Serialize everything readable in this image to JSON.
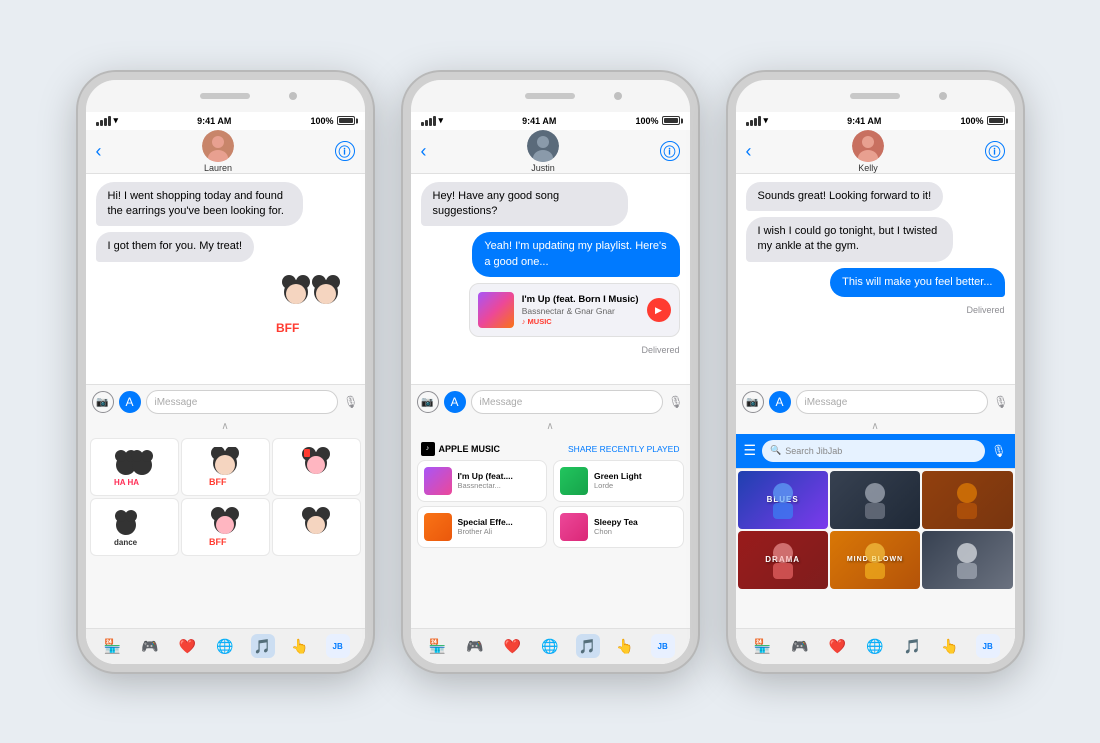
{
  "phones": [
    {
      "id": "phone1",
      "contact": "Lauren",
      "avatar_color": "#c8856a",
      "status_time": "9:41 AM",
      "messages": [
        {
          "type": "incoming",
          "text": "Hi! I went shopping today and found the earrings you've been looking for."
        },
        {
          "type": "incoming",
          "text": "I got them for you. My treat!"
        },
        {
          "type": "sticker",
          "text": "BFF sticker"
        }
      ],
      "panel": "stickers",
      "input_placeholder": "iMessage"
    },
    {
      "id": "phone2",
      "contact": "Justin",
      "avatar_color": "#5a6a7a",
      "status_time": "9:41 AM",
      "messages": [
        {
          "type": "incoming",
          "text": "Hey! Have any good song suggestions?"
        },
        {
          "type": "outgoing",
          "text": "Yeah! I'm updating my playlist. Here's a good one..."
        },
        {
          "type": "music_card",
          "title": "I'm Up (feat. Born I Music)",
          "artist": "Bassnectar & Gnar Gnar",
          "source": "♪ MUSIC"
        },
        {
          "type": "delivered",
          "text": "Delivered"
        }
      ],
      "panel": "apple_music",
      "panel_title": "APPLE MUSIC",
      "panel_action": "SHARE RECENTLY PLAYED",
      "songs": [
        {
          "name": "I'm Up (feat....",
          "artist": "Bassnectar...",
          "color1": "#a855f7",
          "color2": "#ec4899"
        },
        {
          "name": "Green Light",
          "artist": "Lorde",
          "color1": "#22c55e",
          "color2": "#16a34a"
        },
        {
          "name": "Special Effe...",
          "artist": "Brother Ali",
          "color1": "#f97316",
          "color2": "#ea580c"
        },
        {
          "name": "Sleepy Tea",
          "artist": "Chon",
          "color1": "#ec4899",
          "color2": "#db2777"
        }
      ],
      "input_placeholder": "iMessage"
    },
    {
      "id": "phone3",
      "contact": "Kelly",
      "avatar_color": "#c87060",
      "status_time": "9:41 AM",
      "messages": [
        {
          "type": "incoming",
          "text": "Sounds great! Looking forward to it!"
        },
        {
          "type": "incoming",
          "text": "I wish I could go tonight, but I twisted my ankle at the gym."
        },
        {
          "type": "outgoing",
          "text": "This will make you feel better..."
        },
        {
          "type": "delivered",
          "text": "Delivered"
        }
      ],
      "panel": "jibjab",
      "panel_search": "Search JibJab",
      "jibjab_items": [
        {
          "label": "BLUES",
          "bg1": "#1e40af",
          "bg2": "#7c3aed"
        },
        {
          "label": "",
          "bg1": "#374151",
          "bg2": "#1f2937"
        },
        {
          "label": "",
          "bg1": "#92400e",
          "bg2": "#78350f"
        },
        {
          "label": "DRAMA",
          "bg1": "#991b1b",
          "bg2": "#7f1d1d"
        },
        {
          "label": "MIND BLOWN",
          "bg1": "#d97706",
          "bg2": "#b45309"
        },
        {
          "label": "",
          "bg1": "#374151",
          "bg2": "#6b7280"
        }
      ],
      "input_placeholder": "iMessage"
    }
  ],
  "dock_icons": [
    "🏪",
    "🎮",
    "❤️",
    "🌐",
    "🎵",
    "👆",
    "JB"
  ],
  "status": {
    "time": "9:41 AM",
    "battery": "100%"
  }
}
